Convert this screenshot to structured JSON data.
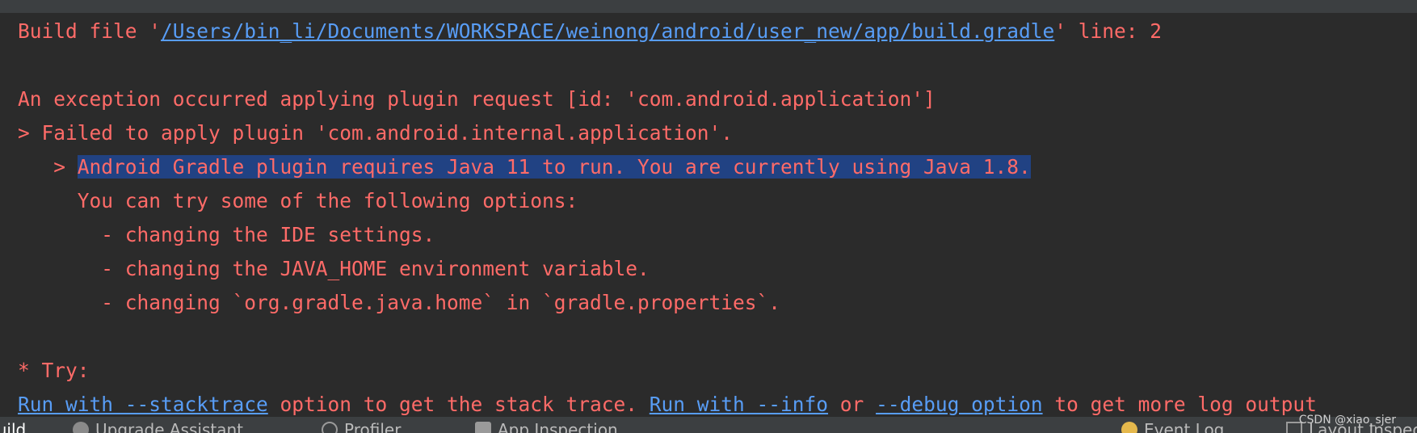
{
  "console": {
    "build_file_prefix": "Build file '",
    "build_file_path": "/Users/bin_li/Documents/WORKSPACE/weinong/android/user_new/app/build.gradle",
    "build_file_suffix": "' line: 2",
    "exception_line": "An exception occurred applying plugin request [id: 'com.android.application']",
    "failed_line": "> Failed to apply plugin 'com.android.internal.application'.",
    "nested_prefix": "   > ",
    "error_selected": "Android Gradle plugin requires Java 11 to run. You are currently using Java 1.8.",
    "options_intro": "     You can try some of the following options:",
    "option_1": "       - changing the IDE settings.",
    "option_2": "       - changing the JAVA_HOME environment variable.",
    "option_3": "       - changing `org.gradle.java.home` in `gradle.properties`.",
    "try_header": "* Try:",
    "try_link_1": "Run with --stacktrace",
    "try_text_1": " option to get the stack trace. ",
    "try_link_2": "Run with --info",
    "try_text_2": " or ",
    "try_link_3": "--debug option",
    "try_text_3": " to get more log output"
  },
  "statusbar": {
    "build_tab": "Build",
    "upgrade_assistant": "Upgrade Assistant",
    "profiler": "Profiler",
    "app_inspection": "App Inspection",
    "event_log": "Event Log",
    "layout_inspector": "Layout Inspector"
  },
  "watermark": "CSDN @xiao_sjer",
  "colors": {
    "background": "#2b2b2b",
    "error_text": "#ff6b68",
    "link": "#589df6",
    "selection": "#214283",
    "toolbar": "#3c3f41"
  },
  "icons": [
    "upgrade-assistant-icon",
    "profiler-icon",
    "app-inspection-icon",
    "event-log-icon",
    "layout-inspector-icon"
  ]
}
